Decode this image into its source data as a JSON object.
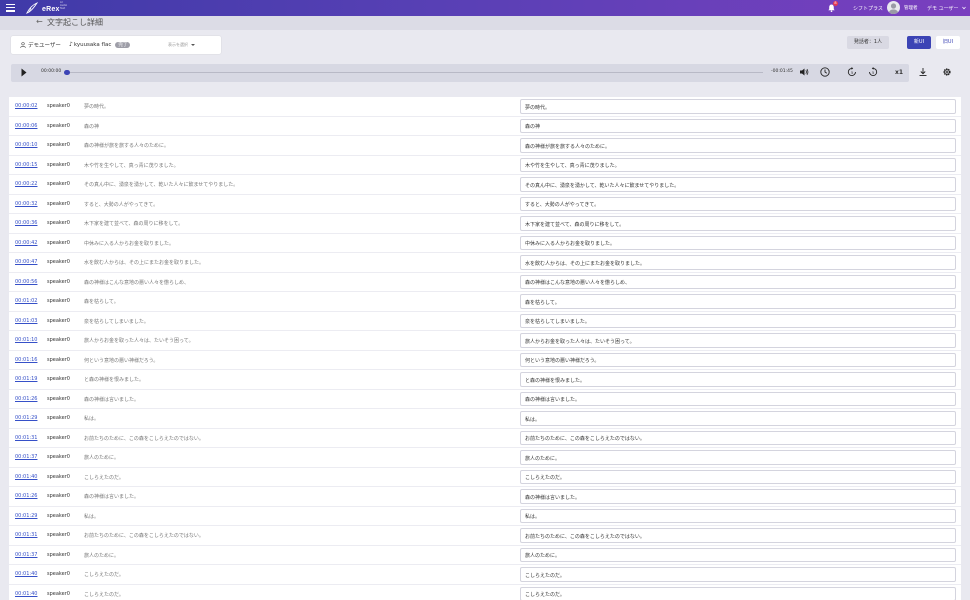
{
  "header": {
    "logo_text": "eRex",
    "logo_sub": "AI Audio Text",
    "notification_count": "8",
    "company": "シフトプラス",
    "role": "管理者",
    "user_name": "デモ ユーザー"
  },
  "page": {
    "title": "文字起こし詳細"
  },
  "info": {
    "owner": "デモユーザー",
    "file_name": "kyuusaka flac",
    "tag": "完了",
    "select_placeholder": "表示を選択"
  },
  "actions": {
    "speaker_count": "発話者：1人",
    "new_ui": "新UI",
    "old_ui": "旧UI"
  },
  "player": {
    "current_time": "00:00:00",
    "remaining_time": "-00:01:45",
    "speed": "x1",
    "progress": 0
  },
  "rows": [
    {
      "time": "00:00:02",
      "speaker": "speaker0",
      "original": "夢の時代。",
      "edited": "夢の時代。"
    },
    {
      "time": "00:00:06",
      "speaker": "speaker0",
      "original": "森の神",
      "edited": "森の神"
    },
    {
      "time": "00:00:10",
      "speaker": "speaker0",
      "original": "森の神様が旅を旅する人々のために。",
      "edited": "森の神様が旅を旅する人々のために。"
    },
    {
      "time": "00:00:15",
      "speaker": "speaker0",
      "original": "木や竹を生やして、真っ青に茂りました。",
      "edited": "木や竹を生やして、真っ青に茂りました。"
    },
    {
      "time": "00:00:22",
      "speaker": "speaker0",
      "original": "その真ん中に、湧泉を湧かして、乾いた人々に飲ませてやりました。",
      "edited": "その真ん中に、湧泉を湧かして、乾いた人々に飲ませてやりました。"
    },
    {
      "time": "00:00:32",
      "speaker": "speaker0",
      "original": "すると、大勢の人がやってきて。",
      "edited": "すると、大勢の人がやってきて。"
    },
    {
      "time": "00:00:36",
      "speaker": "speaker0",
      "original": "木下家を建て並べて、森の周りに移をして。",
      "edited": "木下家を建て並べて、森の周りに移をして。"
    },
    {
      "time": "00:00:42",
      "speaker": "speaker0",
      "original": "中休みに入る人からお金を取りました。",
      "edited": "中休みに入る人からお金を取りました。"
    },
    {
      "time": "00:00:47",
      "speaker": "speaker0",
      "original": "水を飲む人からは、その上にまたお金を取りました。",
      "edited": "水を飲む人からは、その上にまたお金を取りました。"
    },
    {
      "time": "00:00:56",
      "speaker": "speaker0",
      "original": "森の神様はこんな意地の悪い人々を懲らしめ、",
      "edited": "森の神様はこんな意地の悪い人々を懲らしめ、"
    },
    {
      "time": "00:01:02",
      "speaker": "speaker0",
      "original": "森を枯らして。",
      "edited": "森を枯らして。"
    },
    {
      "time": "00:01:03",
      "speaker": "speaker0",
      "original": "泉を枯らしてしまいました。",
      "edited": "泉を枯らしてしまいました。"
    },
    {
      "time": "00:01:10",
      "speaker": "speaker0",
      "original": "旅人からお金を取った人々は、たいそう困って。",
      "edited": "旅人からお金を取った人々は、たいそう困って。"
    },
    {
      "time": "00:01:16",
      "speaker": "speaker0",
      "original": "何という意地の悪い神様だろう。",
      "edited": "何という意地の悪い神様だろう。"
    },
    {
      "time": "00:01:19",
      "speaker": "speaker0",
      "original": "と森の神様を恨みました。",
      "edited": "と森の神様を恨みました。"
    },
    {
      "time": "00:01:26",
      "speaker": "speaker0",
      "original": "森の神様は言いました。",
      "edited": "森の神様は言いました。"
    },
    {
      "time": "00:01:29",
      "speaker": "speaker0",
      "original": "私は。",
      "edited": "私は。"
    },
    {
      "time": "00:01:31",
      "speaker": "speaker0",
      "original": "お前たちのために、この森をこしらえたのではない。",
      "edited": "お前たちのために、この森をこしらえたのではない。"
    },
    {
      "time": "00:01:37",
      "speaker": "speaker0",
      "original": "旅人のために。",
      "edited": "旅人のために。"
    },
    {
      "time": "00:01:40",
      "speaker": "speaker0",
      "original": "こしらえたのだ。",
      "edited": "こしらえたのだ。"
    },
    {
      "time": "00:01:26",
      "speaker": "speaker0",
      "original": "森の神様は言いました。",
      "edited": "森の神様は言いました。"
    },
    {
      "time": "00:01:29",
      "speaker": "speaker0",
      "original": "私は。",
      "edited": "私は。"
    },
    {
      "time": "00:01:31",
      "speaker": "speaker0",
      "original": "お前たちのために、この森をこしらえたのではない。",
      "edited": "お前たちのために、この森をこしらえたのではない。"
    },
    {
      "time": "00:01:37",
      "speaker": "speaker0",
      "original": "旅人のために。",
      "edited": "旅人のために。"
    },
    {
      "time": "00:01:40",
      "speaker": "speaker0",
      "original": "こしらえたのだ。",
      "edited": "こしらえたのだ。"
    },
    {
      "time": "00:01:40",
      "speaker": "speaker0",
      "original": "こしらえたのだ。",
      "edited": "こしらえたのだ。"
    }
  ]
}
